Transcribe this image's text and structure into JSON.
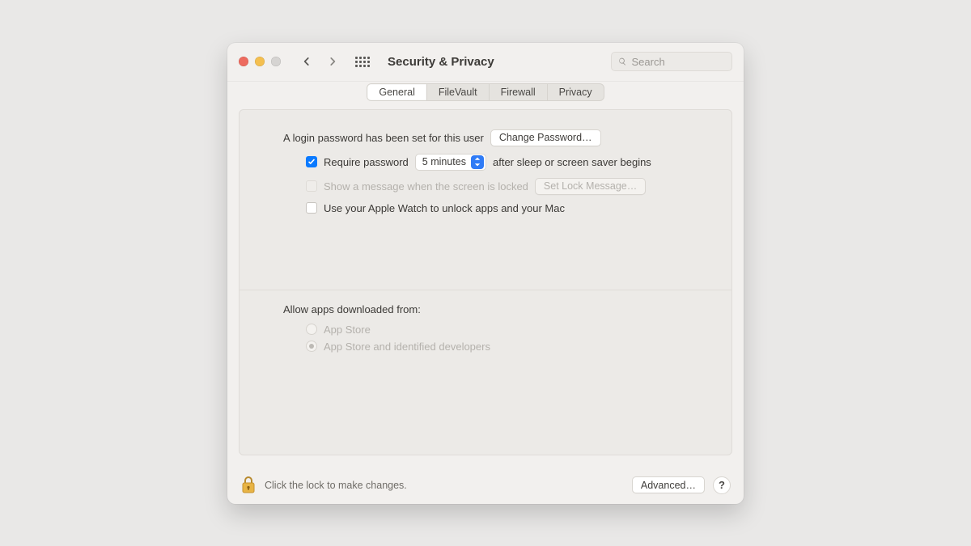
{
  "window": {
    "title": "Security & Privacy"
  },
  "search": {
    "placeholder": "Search",
    "value": ""
  },
  "tabs": [
    {
      "label": "General"
    },
    {
      "label": "FileVault"
    },
    {
      "label": "Firewall"
    },
    {
      "label": "Privacy"
    }
  ],
  "general": {
    "login_password_text": "A login password has been set for this user",
    "change_password_btn": "Change Password…",
    "require_password_label": "Require password",
    "require_password_delay": "5 minutes",
    "require_password_suffix": "after sleep or screen saver begins",
    "show_message_label": "Show a message when the screen is locked",
    "set_lock_message_btn": "Set Lock Message…",
    "apple_watch_label": "Use your Apple Watch to unlock apps and your Mac",
    "allow_apps_label": "Allow apps downloaded from:",
    "allow_apps_options": [
      "App Store",
      "App Store and identified developers"
    ]
  },
  "footer": {
    "lock_text": "Click the lock to make changes.",
    "advanced_btn": "Advanced…",
    "help": "?"
  }
}
